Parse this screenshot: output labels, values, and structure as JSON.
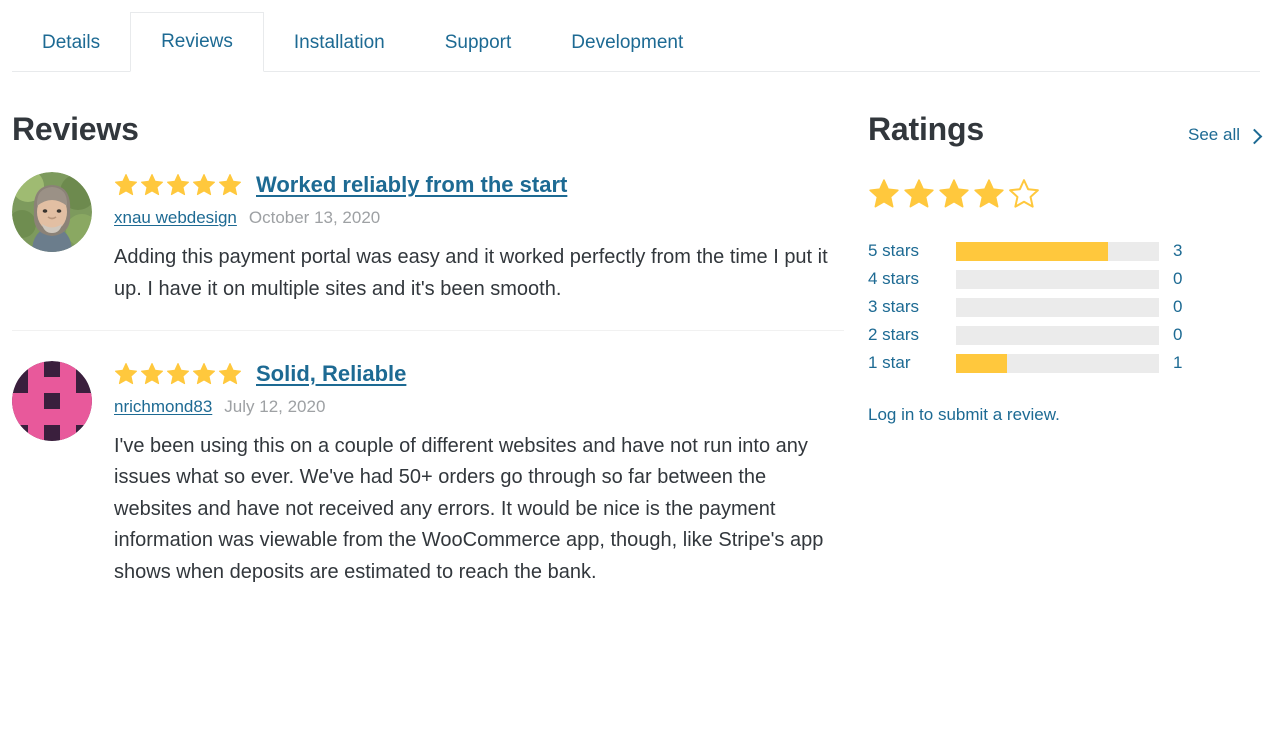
{
  "tabs": [
    {
      "label": "Details",
      "active": false
    },
    {
      "label": "Reviews",
      "active": true
    },
    {
      "label": "Installation",
      "active": false
    },
    {
      "label": "Support",
      "active": false
    },
    {
      "label": "Development",
      "active": false
    }
  ],
  "reviews_section": {
    "title": "Reviews",
    "items": [
      {
        "stars": 5,
        "title": "Worked reliably from the start",
        "author": "xnau webdesign",
        "date": "October 13, 2020",
        "body": "Adding this payment portal was easy and it worked perfectly from the time I put it up. I have it on multiple sites and it's been smooth.",
        "avatar_type": "photo"
      },
      {
        "stars": 5,
        "title": "Solid, Reliable",
        "author": "nrichmond83",
        "date": "July 12, 2020",
        "body": "I've been using this on a couple of different websites and have not run into any issues what so ever. We've had 50+ orders go through so far between the websites and have not received any errors. It would be nice is the payment information was viewable from the WooCommerce app, though, like Stripe's app shows when deposits are estimated to reach the bank.",
        "avatar_type": "identicon"
      }
    ]
  },
  "ratings_section": {
    "title": "Ratings",
    "see_all_label": "See all",
    "see_all_icon": "chevron-right-icon",
    "average_stars_filled": 4,
    "average_stars_total": 5,
    "breakdown": [
      {
        "label": "5 stars",
        "count": "3",
        "percent": 75
      },
      {
        "label": "4 stars",
        "count": "0",
        "percent": 0
      },
      {
        "label": "3 stars",
        "count": "0",
        "percent": 0
      },
      {
        "label": "2 stars",
        "count": "0",
        "percent": 0
      },
      {
        "label": "1 star",
        "count": "1",
        "percent": 25
      }
    ],
    "login_prompt": "Log in to submit a review."
  },
  "colors": {
    "link": "#1d6a93",
    "star_gold": "#ffc83d",
    "bar_track": "#ebebeb",
    "text": "#32373c",
    "muted": "#9ea1a4"
  }
}
